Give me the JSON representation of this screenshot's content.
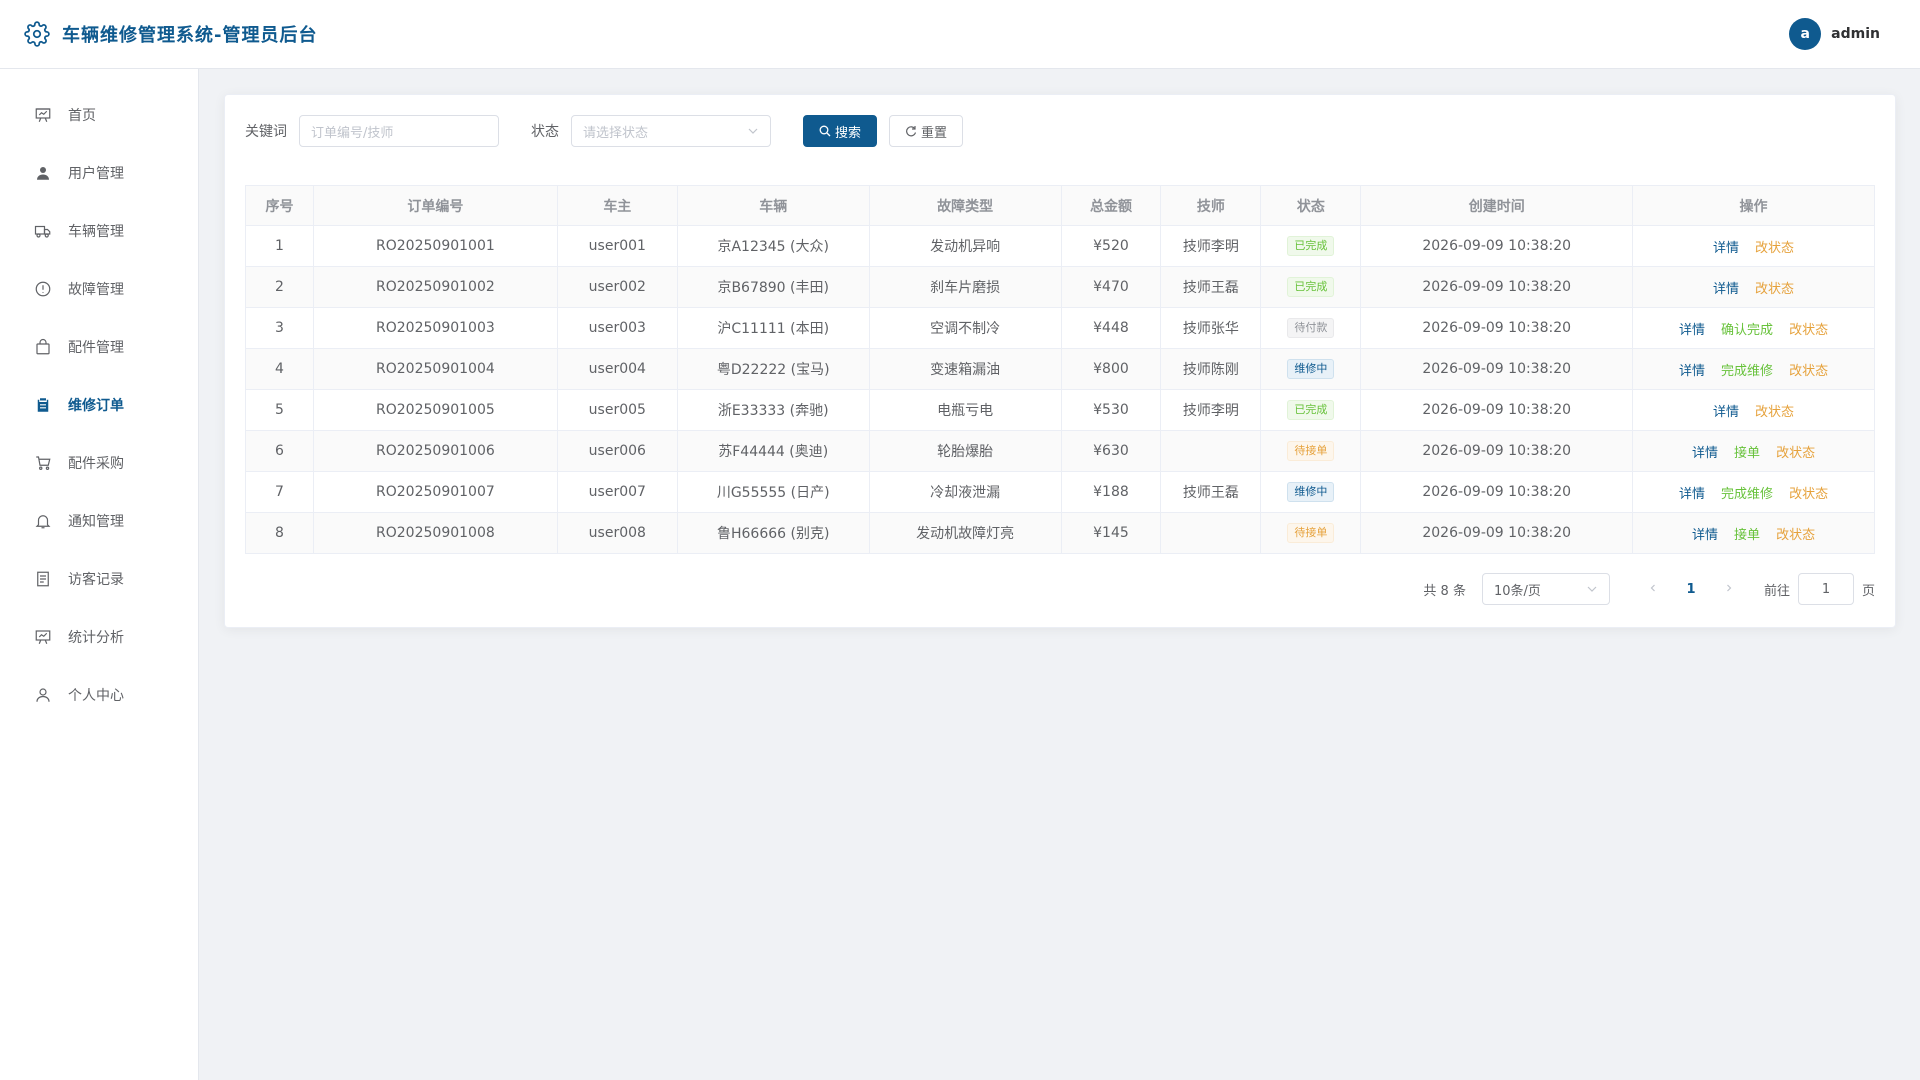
{
  "header": {
    "title": "车辆维修管理系统-管理员后台",
    "avatar_letter": "a",
    "username": "admin"
  },
  "sidebar": {
    "items": [
      {
        "label": "首页",
        "icon": "dashboard-icon"
      },
      {
        "label": "用户管理",
        "icon": "user-icon"
      },
      {
        "label": "车辆管理",
        "icon": "truck-icon"
      },
      {
        "label": "故障管理",
        "icon": "warning-icon"
      },
      {
        "label": "配件管理",
        "icon": "bag-icon"
      },
      {
        "label": "维修订单",
        "icon": "clipboard-icon"
      },
      {
        "label": "配件采购",
        "icon": "cart-icon"
      },
      {
        "label": "通知管理",
        "icon": "bell-icon"
      },
      {
        "label": "访客记录",
        "icon": "document-icon"
      },
      {
        "label": "统计分析",
        "icon": "chart-icon"
      },
      {
        "label": "个人中心",
        "icon": "person-icon"
      }
    ],
    "active_index": 5
  },
  "search": {
    "keyword_label": "关键词",
    "keyword_placeholder": "订单编号/技师",
    "status_label": "状态",
    "status_placeholder": "请选择状态",
    "search_button": "搜索",
    "reset_button": "重置"
  },
  "table": {
    "headers": [
      "序号",
      "订单编号",
      "车主",
      "车辆",
      "故障类型",
      "总金额",
      "技师",
      "状态",
      "创建时间",
      "操作"
    ],
    "rows": [
      {
        "index": "1",
        "order": "RO20250901001",
        "owner": "user001",
        "vehicle": "京A12345 (大众)",
        "fault": "发动机异响",
        "amount": "¥520",
        "tech": "技师李明",
        "status": "已完成",
        "status_type": "done",
        "time": "2026-09-09 10:38:20",
        "actions": [
          {
            "label": "详情",
            "type": "detail"
          },
          {
            "label": "改状态",
            "type": "orange"
          }
        ]
      },
      {
        "index": "2",
        "order": "RO20250901002",
        "owner": "user002",
        "vehicle": "京B67890 (丰田)",
        "fault": "刹车片磨损",
        "amount": "¥470",
        "tech": "技师王磊",
        "status": "已完成",
        "status_type": "done",
        "time": "2026-09-09 10:38:20",
        "actions": [
          {
            "label": "详情",
            "type": "detail"
          },
          {
            "label": "改状态",
            "type": "orange"
          }
        ]
      },
      {
        "index": "3",
        "order": "RO20250901003",
        "owner": "user003",
        "vehicle": "沪C11111 (本田)",
        "fault": "空调不制冷",
        "amount": "¥448",
        "tech": "技师张华",
        "status": "待付款",
        "status_type": "pay",
        "time": "2026-09-09 10:38:20",
        "actions": [
          {
            "label": "详情",
            "type": "detail"
          },
          {
            "label": "确认完成",
            "type": "green"
          },
          {
            "label": "改状态",
            "type": "orange"
          }
        ]
      },
      {
        "index": "4",
        "order": "RO20250901004",
        "owner": "user004",
        "vehicle": "粤D22222 (宝马)",
        "fault": "变速箱漏油",
        "amount": "¥800",
        "tech": "技师陈刚",
        "status": "维修中",
        "status_type": "repair",
        "time": "2026-09-09 10:38:20",
        "actions": [
          {
            "label": "详情",
            "type": "detail"
          },
          {
            "label": "完成维修",
            "type": "green"
          },
          {
            "label": "改状态",
            "type": "orange"
          }
        ]
      },
      {
        "index": "5",
        "order": "RO20250901005",
        "owner": "user005",
        "vehicle": "浙E33333 (奔驰)",
        "fault": "电瓶亏电",
        "amount": "¥530",
        "tech": "技师李明",
        "status": "已完成",
        "status_type": "done",
        "time": "2026-09-09 10:38:20",
        "actions": [
          {
            "label": "详情",
            "type": "detail"
          },
          {
            "label": "改状态",
            "type": "orange"
          }
        ]
      },
      {
        "index": "6",
        "order": "RO20250901006",
        "owner": "user006",
        "vehicle": "苏F44444 (奥迪)",
        "fault": "轮胎爆胎",
        "amount": "¥630",
        "tech": "",
        "status": "待接单",
        "status_type": "wait",
        "time": "2026-09-09 10:38:20",
        "actions": [
          {
            "label": "详情",
            "type": "detail"
          },
          {
            "label": "接单",
            "type": "green"
          },
          {
            "label": "改状态",
            "type": "orange"
          }
        ]
      },
      {
        "index": "7",
        "order": "RO20250901007",
        "owner": "user007",
        "vehicle": "川G55555 (日产)",
        "fault": "冷却液泄漏",
        "amount": "¥188",
        "tech": "技师王磊",
        "status": "维修中",
        "status_type": "repair",
        "time": "2026-09-09 10:38:20",
        "actions": [
          {
            "label": "详情",
            "type": "detail"
          },
          {
            "label": "完成维修",
            "type": "green"
          },
          {
            "label": "改状态",
            "type": "orange"
          }
        ]
      },
      {
        "index": "8",
        "order": "RO20250901008",
        "owner": "user008",
        "vehicle": "鲁H66666 (别克)",
        "fault": "发动机故障灯亮",
        "amount": "¥145",
        "tech": "",
        "status": "待接单",
        "status_type": "wait",
        "time": "2026-09-09 10:38:20",
        "actions": [
          {
            "label": "详情",
            "type": "detail"
          },
          {
            "label": "接单",
            "type": "green"
          },
          {
            "label": "改状态",
            "type": "orange"
          }
        ]
      }
    ]
  },
  "pagination": {
    "total_text": "共 8 条",
    "page_size": "10条/页",
    "current_page": "1",
    "goto_label": "前往",
    "goto_value": "1",
    "page_suffix": "页"
  },
  "colors": {
    "primary": "#0f5a8f",
    "success": "#67c23a",
    "warning": "#e6a23c",
    "info": "#909399"
  }
}
